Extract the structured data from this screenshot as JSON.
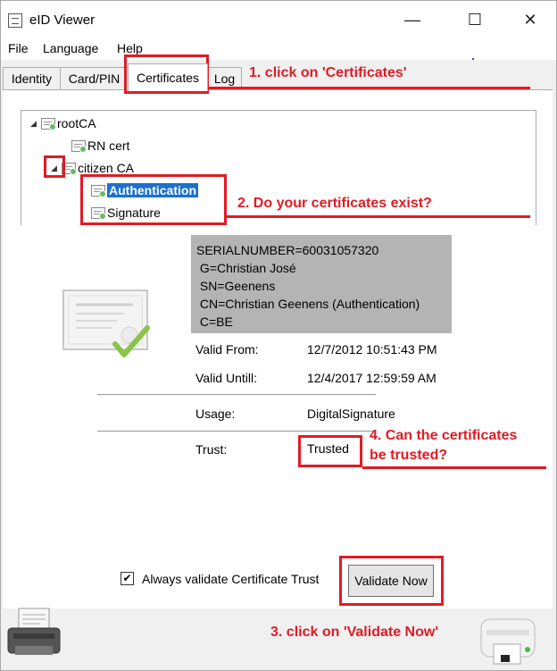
{
  "window": {
    "title": "eID Viewer",
    "minimize": "—",
    "maximize": "☐",
    "close": "✕"
  },
  "menu": [
    "File",
    "Language",
    "Help"
  ],
  "tabs": [
    "Identity",
    "Card/PIN",
    "Certificates",
    "Log"
  ],
  "tree": {
    "root": "rootCA",
    "rn": "RN cert",
    "citizen": "citizen CA",
    "auth": "Authentication",
    "sig": "Signature"
  },
  "subject": [
    "SERIALNUMBER=60031057320",
    " G=Christian José",
    " SN=Geenens",
    " CN=Christian Geenens (Authentication)",
    " C=BE"
  ],
  "details": {
    "valid_from_label": "Valid From:",
    "valid_from": "12/7/2012 10:51:43 PM",
    "valid_until_label": "Valid Untill:",
    "valid_until": "12/4/2017 12:59:59 AM",
    "usage_label": "Usage:",
    "usage": "DigitalSignature",
    "trust_label": "Trust:",
    "trust": "Trusted"
  },
  "always_validate": "Always validate Certificate Trust",
  "validate_button": "Validate Now",
  "annotations": {
    "a1": "1. click on 'Certificates'",
    "a2": "2. Do your certificates exist?",
    "a3": "3. click on 'Validate Now'",
    "a4_line1": "4. Can the certificates",
    "a4_line2": "be trusted?"
  },
  "colors": {
    "annotation": "#e01b24",
    "selection": "#1a6fd1"
  }
}
